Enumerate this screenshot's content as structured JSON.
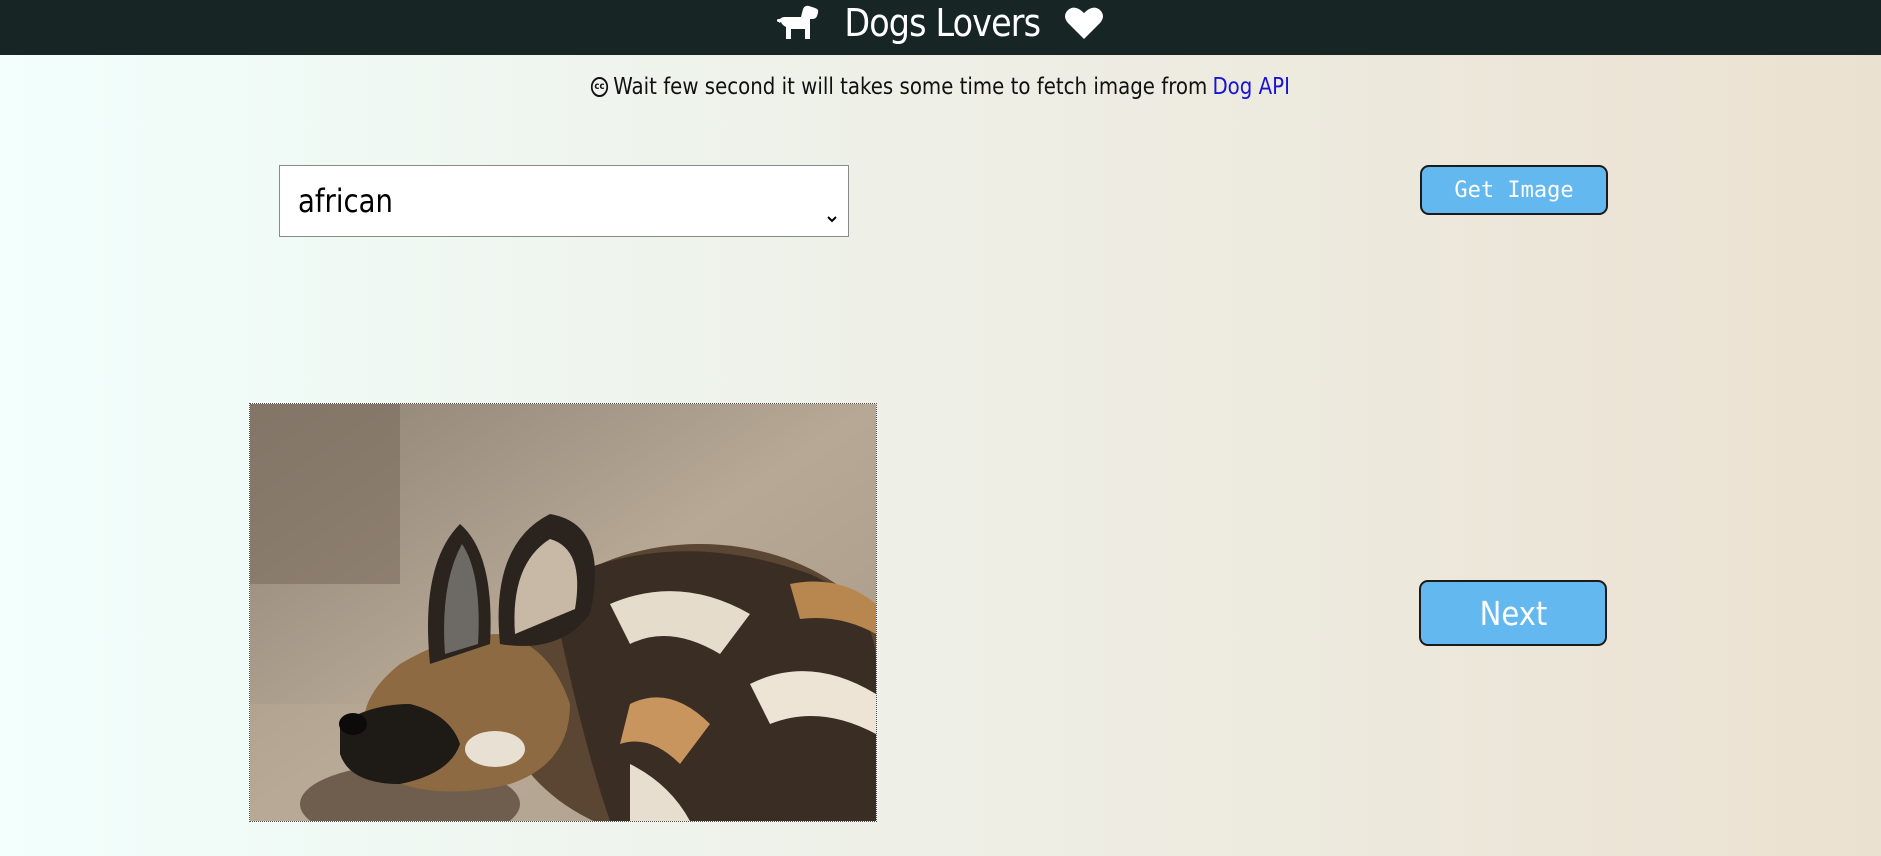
{
  "header": {
    "title": "Dogs Lovers",
    "left_icon": "dog-icon",
    "right_icon": "heart-icon",
    "background": "#172524"
  },
  "notice": {
    "icon": "creative-commons-icon",
    "text": "Wait few second it will takes some time to fetch image from",
    "link_text": "Dog API"
  },
  "breed_select": {
    "selected": "african"
  },
  "buttons": {
    "get_image": "Get Image",
    "next": "Next",
    "color": "#63b8ef"
  }
}
